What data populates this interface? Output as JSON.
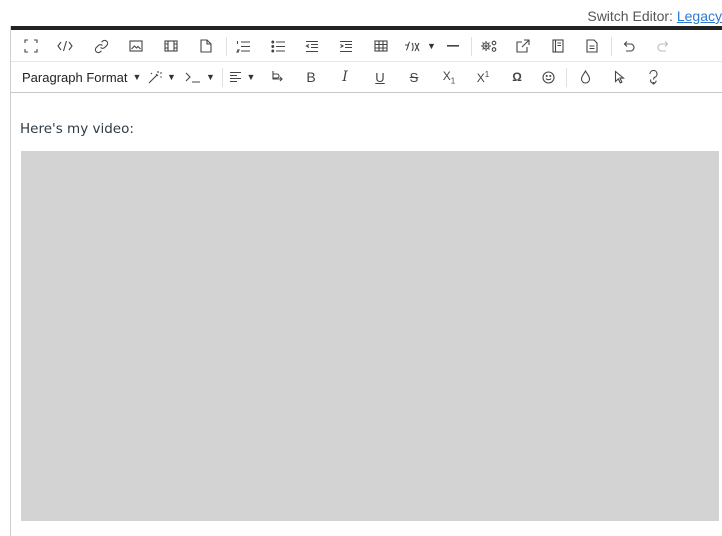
{
  "switch_editor": {
    "label": "Switch Editor: ",
    "link": "Legacy"
  },
  "toolbar": {
    "row1": [
      {
        "name": "fullscreen-button",
        "icon": "fullscreen-icon"
      },
      {
        "name": "html-source-button",
        "icon": "code-icon"
      },
      {
        "name": "insert-link-button",
        "icon": "link-icon"
      },
      {
        "name": "insert-image-button",
        "icon": "image-icon"
      },
      {
        "name": "insert-media-button",
        "icon": "film-icon"
      },
      {
        "name": "insert-document-button",
        "icon": "document-icon"
      },
      {
        "name": "ordered-list-button",
        "icon": "ordered-list-icon"
      },
      {
        "name": "bullet-list-button",
        "icon": "bullet-list-icon"
      },
      {
        "name": "outdent-button",
        "icon": "outdent-icon"
      },
      {
        "name": "indent-button",
        "icon": "indent-icon"
      },
      {
        "name": "insert-table-button",
        "icon": "table-icon"
      },
      {
        "name": "insert-equation-button",
        "icon": "math-icon"
      },
      {
        "name": "horizontal-rule-button",
        "icon": "minus-icon"
      },
      {
        "name": "apps-button",
        "icon": "apps-gear-icon"
      },
      {
        "name": "external-tool-button",
        "icon": "external-link-icon"
      },
      {
        "name": "content-button",
        "icon": "book-icon"
      },
      {
        "name": "page-button",
        "icon": "page-icon"
      },
      {
        "name": "undo-button",
        "icon": "undo-icon"
      },
      {
        "name": "redo-button",
        "icon": "redo-icon"
      }
    ],
    "row2": {
      "paragraph_format": "Paragraph Format",
      "bold": "B",
      "italic": "I",
      "underline": "U",
      "strikethrough": "S",
      "subscript_base": "X",
      "subscript_mark": "1",
      "superscript_base": "X",
      "superscript_mark": "1",
      "special_char": "Ω"
    }
  },
  "content": {
    "paragraph": "Here's my video:"
  },
  "colors": {
    "accent_link": "#2b7bd6",
    "placeholder_bg": "#d3d3d3",
    "toolbar_topline": "#222222"
  }
}
